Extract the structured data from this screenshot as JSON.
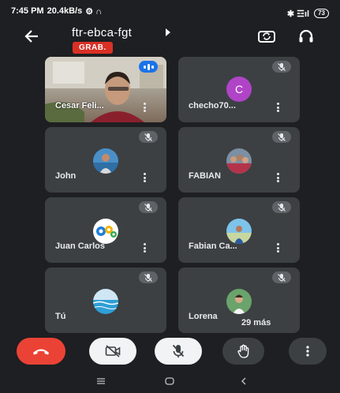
{
  "status_bar": {
    "time": "7:45 PM",
    "speed": "20.4kB/s",
    "extra": "⚙ ∩",
    "signals": "✱ ☲ıl",
    "battery": "73"
  },
  "header": {
    "title": "ftr-ebca-fgt",
    "recording_label": "GRAB."
  },
  "participants": [
    {
      "name": "Cesar Feli...",
      "type": "video"
    },
    {
      "name": "checho70...",
      "type": "letter",
      "initial": "C",
      "color": "#b044c7"
    },
    {
      "name": "John",
      "type": "photo"
    },
    {
      "name": "FABIAN",
      "type": "photo"
    },
    {
      "name": "Juan Carlos",
      "type": "photo"
    },
    {
      "name": "Fabian Ca...",
      "type": "photo"
    },
    {
      "name": "Tú",
      "type": "photo"
    },
    {
      "name": "Lorena",
      "type": "photo"
    }
  ],
  "more_participants": "29 más",
  "colors": {
    "end_call": "#ea4335",
    "recording": "#d93025",
    "speaking": "#1a73e8",
    "tile": "#3c4043"
  }
}
